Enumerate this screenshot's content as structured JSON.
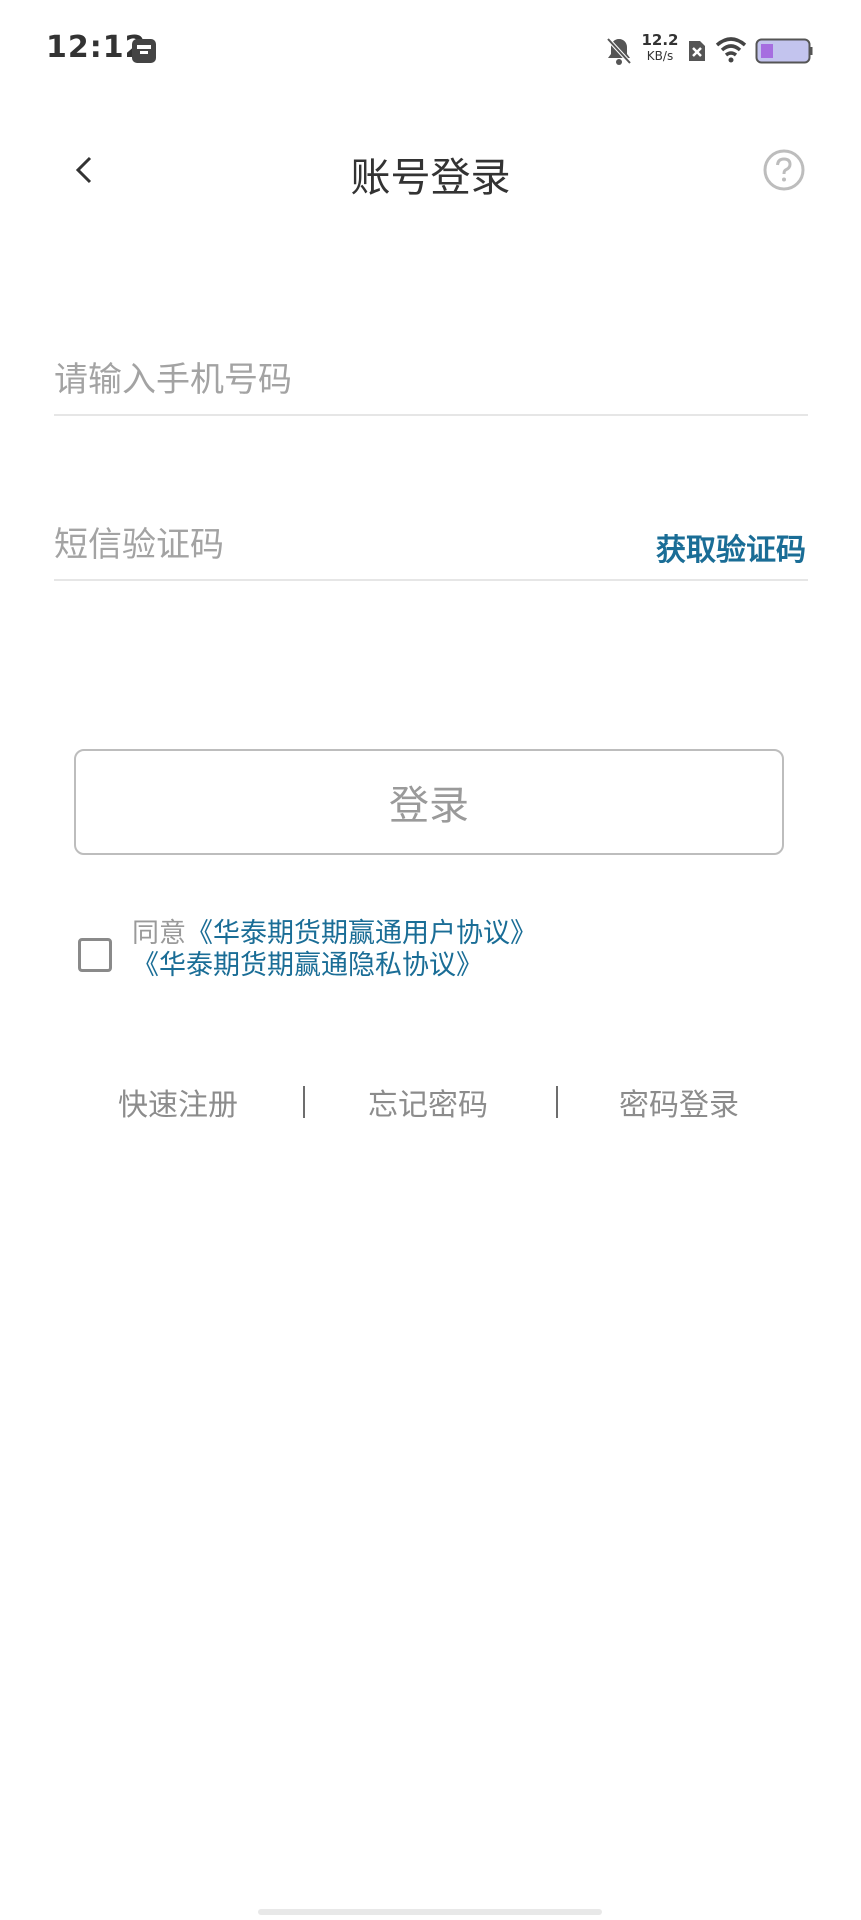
{
  "status_bar": {
    "time": "12:12",
    "net_speed_value": "12.2",
    "net_speed_unit": "KB/s",
    "icons": [
      "app-icon",
      "mute-bell-icon",
      "no-sim-icon",
      "wifi-icon",
      "battery-icon"
    ]
  },
  "header": {
    "title": "账号登录",
    "back_icon": "chevron-left-icon",
    "help_icon": "question-circle-icon"
  },
  "form": {
    "phone_placeholder": "请输入手机号码",
    "phone_value": "",
    "code_placeholder": "短信验证码",
    "code_value": "",
    "get_code_label": "获取验证码"
  },
  "login_button_label": "登录",
  "agreement": {
    "prefix": "同意",
    "link1": "《华泰期货期赢通用户协议》",
    "link2": "《华泰期货期赢通隐私协议》",
    "checked": false
  },
  "bottom_links": {
    "register": "快速注册",
    "forgot": "忘记密码",
    "password_login": "密码登录"
  },
  "colors": {
    "link": "#1a6d96",
    "placeholder": "#a3a3a3",
    "title": "#333333"
  }
}
